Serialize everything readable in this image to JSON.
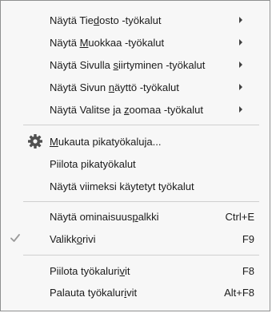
{
  "menu": {
    "items": [
      {
        "pre": "Näytä Tie",
        "ul": "d",
        "post": "osto -työkalut",
        "shortcut": "",
        "submenu": true
      },
      {
        "pre": "Näytä ",
        "ul": "M",
        "post": "uokkaa -työkalut",
        "shortcut": "",
        "submenu": true
      },
      {
        "pre": "Näytä Sivulla ",
        "ul": "s",
        "post": "iirtyminen -työkalut",
        "shortcut": "",
        "submenu": true
      },
      {
        "pre": "Näytä Sivun ",
        "ul": "n",
        "post": "äyttö -työkalut",
        "shortcut": "",
        "submenu": true
      },
      {
        "pre": "Näytä Valitse ja ",
        "ul": "z",
        "post": "oomaa -työkalut",
        "shortcut": "",
        "submenu": true
      },
      {
        "pre": "",
        "ul": "M",
        "post": "ukauta pikatyökaluja...",
        "shortcut": "",
        "icon": "gear-icon"
      },
      {
        "pre": "Piilota pikatyökalut",
        "ul": "",
        "post": "",
        "shortcut": ""
      },
      {
        "pre": "Näytä viimeksi käytetyt työkalut",
        "ul": "",
        "post": "",
        "shortcut": ""
      },
      {
        "pre": "Näytä ominaisuus",
        "ul": "p",
        "post": "alkki",
        "shortcut": "Ctrl+E"
      },
      {
        "pre": "Valikk",
        "ul": "o",
        "post": "rivi",
        "shortcut": "F9",
        "checked": true,
        "icon": "checkmark-icon"
      },
      {
        "pre": "Piilota työkaluri",
        "ul": "v",
        "post": "it",
        "shortcut": "F8"
      },
      {
        "pre": "Palauta työkalur",
        "ul": "i",
        "post": "vit",
        "shortcut": "Alt+F8"
      }
    ]
  }
}
